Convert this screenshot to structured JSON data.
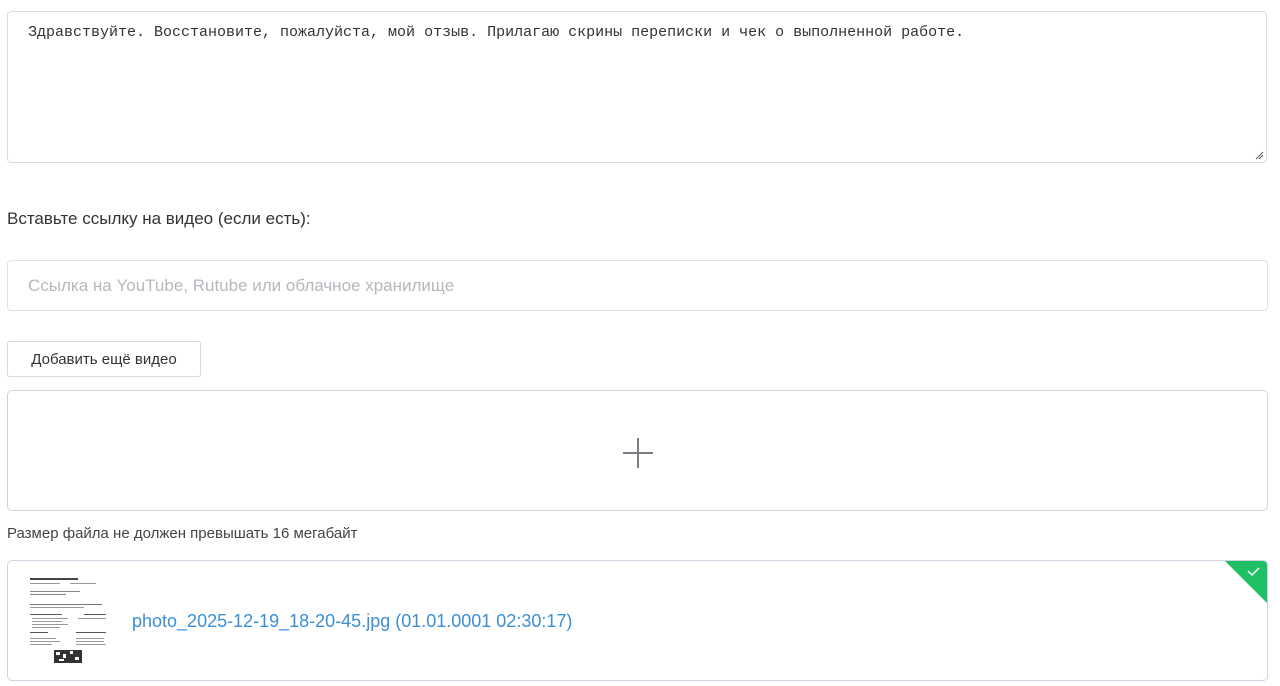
{
  "review": {
    "text": "Здравствуйте. Восстановите, пожалуйста, мой отзыв. Прилагаю скрины переписки и чек о выполненной работе."
  },
  "video": {
    "label": "Вставьте ссылку на видео (если есть):",
    "placeholder": "Ссылка на YouTube, Rutube или облачное хранилище",
    "value": "",
    "add_button": "Добавить ещё видео"
  },
  "upload": {
    "dropzone_icon": "plus-icon",
    "size_note": "Размер файла не должен превышать 16 мегабайт"
  },
  "attachments": [
    {
      "name": "photo_2025-12-19_18-20-45.jpg (01.01.0001 02:30:17)",
      "status_icon": "check-icon",
      "status_color": "#1fbf64"
    }
  ],
  "colors": {
    "link": "#3b8fd6",
    "success": "#1fbf64"
  }
}
